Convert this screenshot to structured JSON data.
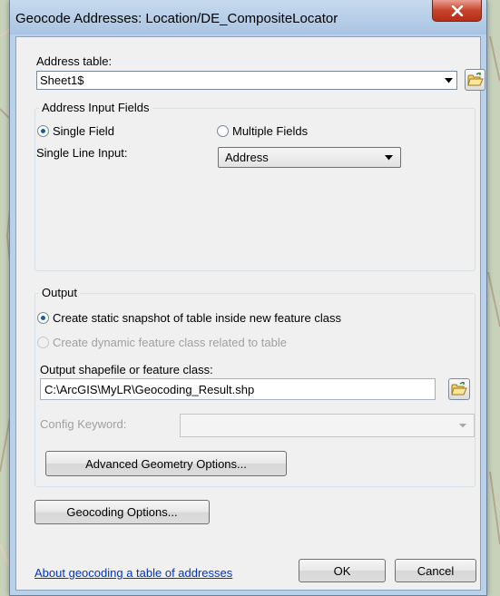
{
  "window": {
    "title": "Geocode Addresses:  Location/DE_CompositeLocator",
    "close_label": "x"
  },
  "address_table": {
    "label": "Address table:",
    "value": "Sheet1$",
    "browse_icon": "open-folder-icon"
  },
  "input_fields": {
    "group_title": "Address Input Fields",
    "single_field_label": "Single Field",
    "single_field_selected": true,
    "multiple_fields_label": "Multiple Fields",
    "multiple_fields_selected": false,
    "single_line_label": "Single Line Input:",
    "single_line_value": "Address"
  },
  "output": {
    "group_title": "Output",
    "static_snapshot_label": "Create static snapshot of table inside new feature class",
    "static_snapshot_selected": true,
    "dynamic_label": "Create dynamic feature class related to table",
    "dynamic_enabled": false,
    "output_label": "Output shapefile or feature class:",
    "output_value": "C:\\ArcGIS\\MyLR\\Geocoding_Result.shp",
    "config_keyword_label": "Config Keyword:",
    "config_keyword_value": "",
    "advanced_button": "Advanced Geometry Options..."
  },
  "geocoding_options_button": "Geocoding Options...",
  "footer": {
    "help_link": "About geocoding a table of addresses",
    "ok_button": "OK",
    "cancel_button": "Cancel"
  },
  "colors": {
    "window_frame": "#b9d1ea",
    "client_bg": "#f0f0f0",
    "close_red": "#c7432b",
    "link_blue": "#0033cc",
    "radio_selected": "#1a5aa8"
  }
}
